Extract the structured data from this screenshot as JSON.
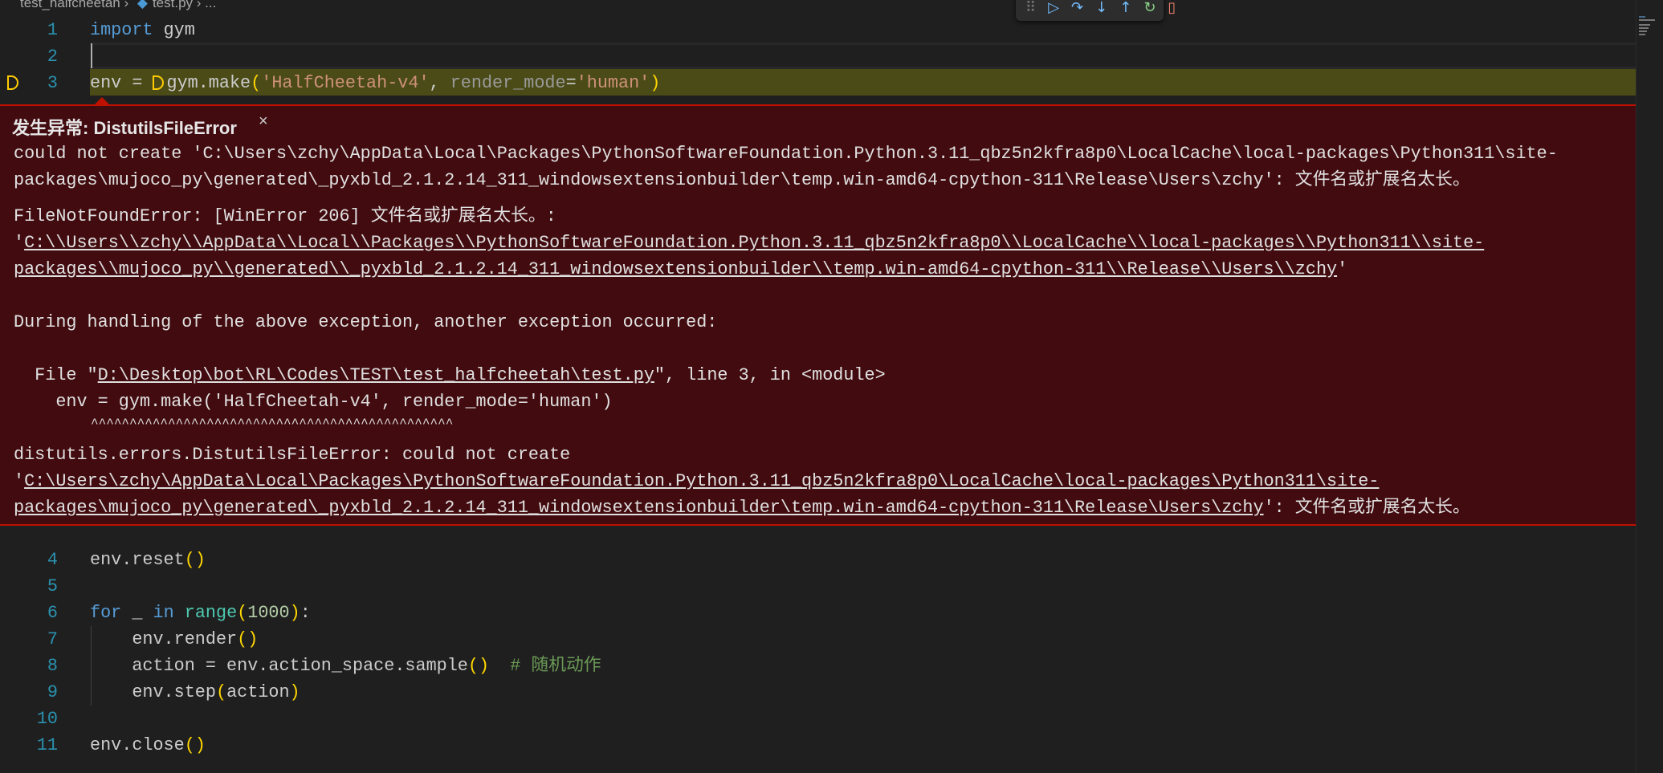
{
  "breadcrumb": {
    "folder": "test_halfcheetah",
    "file": "test.py",
    "more": "..."
  },
  "debug_toolbar": {
    "grip": "⠿",
    "continue": "▷",
    "step_over": "↷",
    "step_into": "↓",
    "step_out": "↑",
    "restart": "↻",
    "stop": "▯"
  },
  "code_top": [
    {
      "n": "1"
    },
    {
      "n": "2"
    },
    {
      "n": "3"
    }
  ],
  "code_tokens": {
    "l1_kw": "import",
    "l1_rest": " gym",
    "l3_a": "env = ",
    "l3_b": "gym.make",
    "l3_p1": "(",
    "l3_s1": "'HalfCheetah-v4'",
    "l3_c": ", ",
    "l3_param": "render_mode",
    "l3_eq": "=",
    "l3_s2": "'human'",
    "l3_p2": ")",
    "l4": "env.reset",
    "l6_for": "for",
    "l6_us": " _ ",
    "l6_in": "in",
    "l6_range": "range",
    "l6_num": "1000",
    "l6_colon": ":",
    "l7": "    env.render",
    "l8": "    action = env.action_space.sample",
    "l8_cm": "# 随机动作",
    "l9": "    env.step",
    "l9_arg": "action",
    "l11": "env.close",
    "po": "(",
    "pc": ")",
    "pp": "()"
  },
  "line_numbers": [
    "1",
    "2",
    "3",
    "4",
    "5",
    "6",
    "7",
    "8",
    "9",
    "10",
    "11"
  ],
  "exception": {
    "title": "发生异常: DistutilsFileError",
    "close": "×",
    "lines": [
      "could not create 'C:\\Users\\zchy\\AppData\\Local\\Packages\\PythonSoftwareFoundation.Python.3.11_qbz5n2kfra8p0\\LocalCache\\local-packages\\Python311\\site-",
      "packages\\mujoco_py\\generated\\_pyxbld_2.1.2.14_311_windowsextensionbuilder\\temp.win-amd64-cpython-311\\Release\\Users\\zchy': 文件名或扩展名太长。",
      "FileNotFoundError: [WinError 206] 文件名或扩展名太长。:",
      "'",
      "C:\\\\Users\\\\zchy\\\\AppData\\\\Local\\\\Packages\\\\PythonSoftwareFoundation.Python.3.11_qbz5n2kfra8p0\\\\LocalCache\\\\local-packages\\\\Python311\\\\site-",
      "packages\\\\mujoco_py\\\\generated\\\\_pyxbld_2.1.2.14_311_windowsextensionbuilder\\\\temp.win-amd64-cpython-311\\\\Release\\\\Users\\\\zchy",
      "'",
      "During handling of the above exception, another exception occurred:",
      "  File \"",
      "D:\\Desktop\\bot\\RL\\Codes\\TEST\\test_halfcheetah\\test.py",
      "\", line 3, in <module>",
      "    env = gym.make('HalfCheetah-v4', render_mode='human')",
      "          ^^^^^^^^^^^^^^^^^^^^^^^^^^^^^^^^^^^^^^^^^^^^^^^",
      "distutils.errors.DistutilsFileError: could not create",
      "'",
      "C:\\Users\\zchy\\AppData\\Local\\Packages\\PythonSoftwareFoundation.Python.3.11_qbz5n2kfra8p0\\LocalCache\\local-packages\\Python311\\site-",
      "packages\\mujoco_py\\generated\\_pyxbld_2.1.2.14_311_windowsextensionbuilder\\temp.win-amd64-cpython-311\\Release\\Users\\zchy",
      "': 文件名或扩展名太长。"
    ]
  },
  "colors": {
    "error_bg": "#420b0f",
    "error_border": "#be1100",
    "highlight": "#4b4b18",
    "editor_bg": "#1f1f1f"
  }
}
